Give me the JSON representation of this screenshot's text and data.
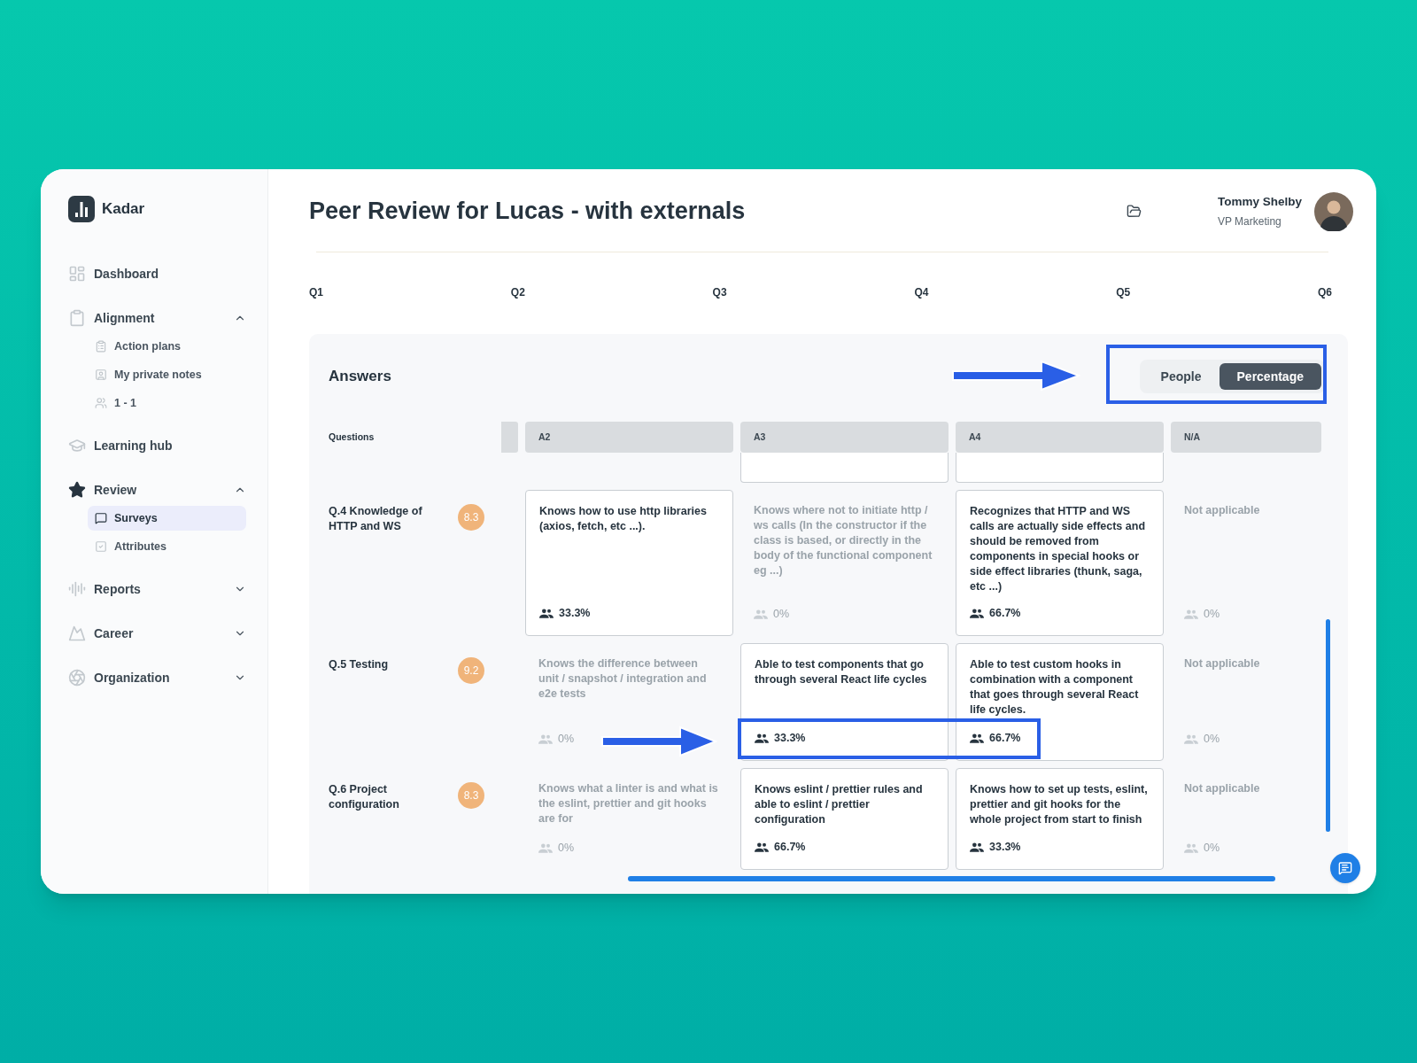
{
  "sidebar": {
    "brand": "Kadar",
    "items": [
      {
        "label": "Dashboard"
      },
      {
        "label": "Alignment",
        "expanded": true,
        "children": [
          {
            "label": "Action plans",
            "selected": false
          },
          {
            "label": "My private notes",
            "selected": false
          },
          {
            "label": "1 - 1",
            "selected": false
          }
        ]
      },
      {
        "label": "Learning hub"
      },
      {
        "label": "Review",
        "expanded": true,
        "children": [
          {
            "label": "Surveys",
            "selected": true
          },
          {
            "label": "Attributes",
            "selected": false
          }
        ]
      },
      {
        "label": "Reports",
        "expanded": false
      },
      {
        "label": "Career",
        "expanded": false
      },
      {
        "label": "Organization",
        "expanded": false
      }
    ]
  },
  "header": {
    "title": "Peer Review for Lucas - with externals",
    "user": {
      "name": "Tommy Shelby",
      "role": "VP Marketing"
    }
  },
  "question_tabs": [
    "Q1",
    "Q2",
    "Q3",
    "Q4",
    "Q5",
    "Q6"
  ],
  "answers": {
    "title": "Answers",
    "toggle": [
      {
        "label": "People",
        "selected": false
      },
      {
        "label": "Percentage",
        "selected": true
      }
    ],
    "questions_heading": "Questions",
    "columns": [
      "A2",
      "A3",
      "A4",
      "N/A"
    ],
    "rows": [
      {
        "question": "Q.4 Knowledge of HTTP and WS",
        "score": "8.3",
        "cells": [
          {
            "text": "Knows how to use http libraries (axios, fetch, etc ...).",
            "share": "33.3%",
            "dimmed": false
          },
          {
            "text": "Knows where not to initiate http / ws calls (In the constructor if the class is based, or directly in the body of the functional component eg ...)",
            "share": "0%",
            "dimmed": true
          },
          {
            "text": "Recognizes that HTTP and WS calls are actually side effects and should be removed from components in special hooks or side effect libraries (thunk, saga, etc ...)",
            "share": "66.7%",
            "dimmed": false
          },
          {
            "text": "Not applicable",
            "share": "0%",
            "dimmed": true
          }
        ]
      },
      {
        "question": "Q.5 Testing",
        "score": "9.2",
        "cells": [
          {
            "text": "Knows the difference between unit / snapshot / integration and e2e tests",
            "share": "0%",
            "dimmed": true
          },
          {
            "text": "Able to test components that go through several React life cycles",
            "share": "33.3%",
            "dimmed": false
          },
          {
            "text": "Able to test custom hooks in combination with a component that goes through several React life cycles.",
            "share": "66.7%",
            "dimmed": false
          },
          {
            "text": "Not applicable",
            "share": "0%",
            "dimmed": true
          }
        ]
      },
      {
        "question": "Q.6 Project configuration",
        "score": "8.3",
        "cells": [
          {
            "text": "Knows what a linter is and what is the eslint, prettier and git hooks are for",
            "share": "0%",
            "dimmed": true
          },
          {
            "text": "Knows eslint / prettier rules and able to eslint / prettier configuration",
            "share": "66.7%",
            "dimmed": false
          },
          {
            "text": "Knows how to set up tests, eslint, prettier and git hooks for the whole project from start to finish",
            "share": "33.3%",
            "dimmed": false
          },
          {
            "text": "Not applicable",
            "share": "0%",
            "dimmed": true
          }
        ]
      }
    ]
  }
}
